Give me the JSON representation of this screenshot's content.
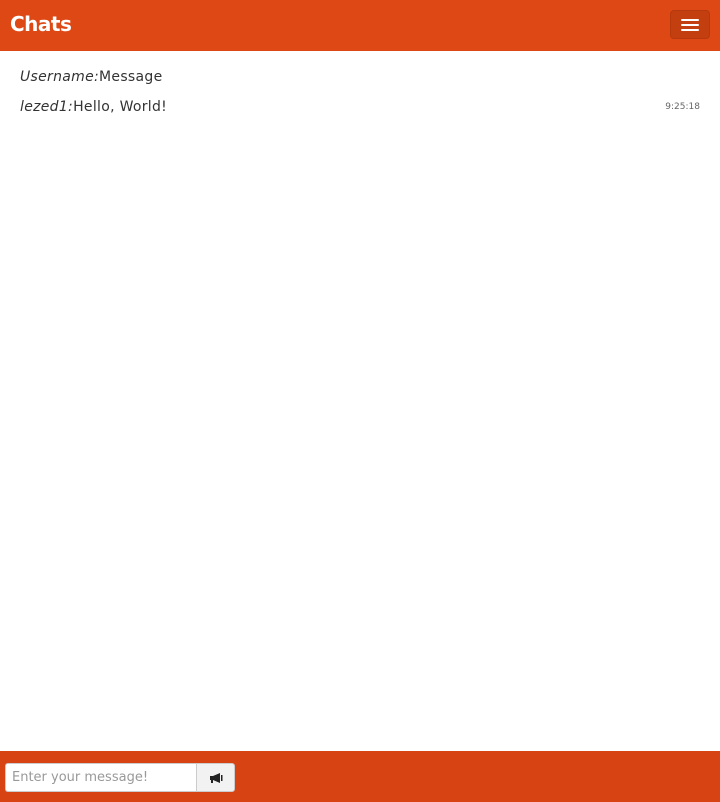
{
  "navbar": {
    "brand": "Chats",
    "menu_icon": "hamburger-menu-icon"
  },
  "messages": {
    "header": {
      "username": "Username:",
      "text": "Message"
    },
    "items": [
      {
        "username": "lezed1:",
        "text": "Hello, World!",
        "time": "9:25:18"
      }
    ]
  },
  "composer": {
    "placeholder": "Enter your message!",
    "value": "",
    "send_icon": "megaphone-icon"
  },
  "colors": {
    "primary": "#dd4814",
    "footer": "#d84313"
  }
}
